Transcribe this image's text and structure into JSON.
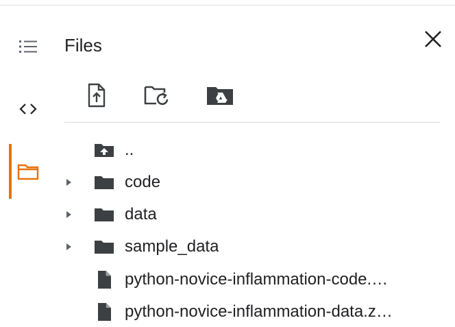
{
  "panel": {
    "title": "Files",
    "close_icon": "close-icon"
  },
  "rail": {
    "items": [
      {
        "icon": "table-of-contents-icon"
      },
      {
        "icon": "code-icon"
      },
      {
        "icon": "folder-icon",
        "active": true
      }
    ],
    "active_color": "#e8710a"
  },
  "toolbar": {
    "buttons": [
      {
        "icon": "upload-file-icon"
      },
      {
        "icon": "refresh-folder-icon"
      },
      {
        "icon": "mount-drive-icon"
      }
    ]
  },
  "tree": {
    "items": [
      {
        "label": "..",
        "type": "parent",
        "icon": "folder-up-icon",
        "expandable": false
      },
      {
        "label": "code",
        "type": "folder",
        "icon": "folder-icon",
        "expandable": true
      },
      {
        "label": "data",
        "type": "folder",
        "icon": "folder-icon",
        "expandable": true
      },
      {
        "label": "sample_data",
        "type": "folder",
        "icon": "folder-icon",
        "expandable": true
      },
      {
        "label": "python-novice-inflammation-code.…",
        "type": "file",
        "icon": "file-icon",
        "expandable": false
      },
      {
        "label": "python-novice-inflammation-data.z…",
        "type": "file",
        "icon": "file-icon",
        "expandable": false
      }
    ]
  }
}
